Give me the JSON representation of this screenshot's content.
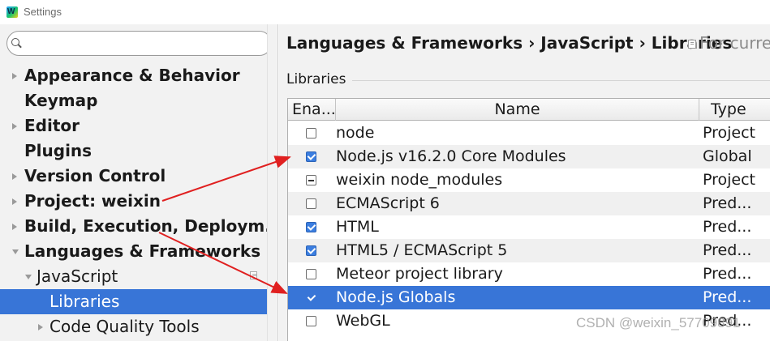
{
  "window": {
    "title": "Settings",
    "app_icon": "webstorm-icon"
  },
  "search": {
    "placeholder": "",
    "value": ""
  },
  "sidebar": {
    "items": [
      {
        "label": "Appearance & Behavior",
        "bold": true,
        "arrow": "right",
        "level": 0
      },
      {
        "label": "Keymap",
        "bold": true,
        "arrow": "none",
        "level": 0
      },
      {
        "label": "Editor",
        "bold": true,
        "arrow": "right",
        "level": 0
      },
      {
        "label": "Plugins",
        "bold": true,
        "arrow": "none",
        "level": 0
      },
      {
        "label": "Version Control",
        "bold": true,
        "arrow": "right",
        "level": 0
      },
      {
        "label": "Project: weixin",
        "bold": true,
        "arrow": "right",
        "level": 0
      },
      {
        "label": "Build, Execution, Deploym...",
        "bold": true,
        "arrow": "right",
        "level": 0
      },
      {
        "label": "Languages & Frameworks",
        "bold": true,
        "arrow": "down",
        "level": 0
      },
      {
        "label": "JavaScript",
        "bold": false,
        "arrow": "down",
        "level": 1
      },
      {
        "label": "Libraries",
        "bold": false,
        "arrow": "none",
        "level": 2,
        "selected": true
      },
      {
        "label": "Code Quality Tools",
        "bold": false,
        "arrow": "right",
        "level": 2
      }
    ]
  },
  "header": {
    "breadcrumb": "Languages & Frameworks › JavaScript › Libraries",
    "scope_text": "For curre"
  },
  "libraries": {
    "group_title": "Libraries",
    "columns": {
      "enabled": "Ena...",
      "name": "Name",
      "type": "Type"
    },
    "rows": [
      {
        "name": "node",
        "type": "Project",
        "state": "unchecked"
      },
      {
        "name": "Node.js v16.2.0 Core Modules",
        "type": "Global",
        "state": "checked"
      },
      {
        "name": "weixin node_modules",
        "type": "Project",
        "state": "partial"
      },
      {
        "name": "ECMAScript 6",
        "type": "Pred...",
        "state": "unchecked"
      },
      {
        "name": "HTML",
        "type": "Pred...",
        "state": "checked"
      },
      {
        "name": "HTML5 / ECMAScript 5",
        "type": "Pred...",
        "state": "checked"
      },
      {
        "name": "Meteor project library",
        "type": "Pred...",
        "state": "unchecked"
      },
      {
        "name": "Node.js Globals",
        "type": "Pred...",
        "state": "checked",
        "selected": true
      },
      {
        "name": "WebGL",
        "type": "Pred...",
        "state": "unchecked"
      }
    ]
  },
  "colors": {
    "selection": "#3875d7",
    "annotation_arrow": "#e02020"
  },
  "watermark": "CSDN @weixin_57709891"
}
